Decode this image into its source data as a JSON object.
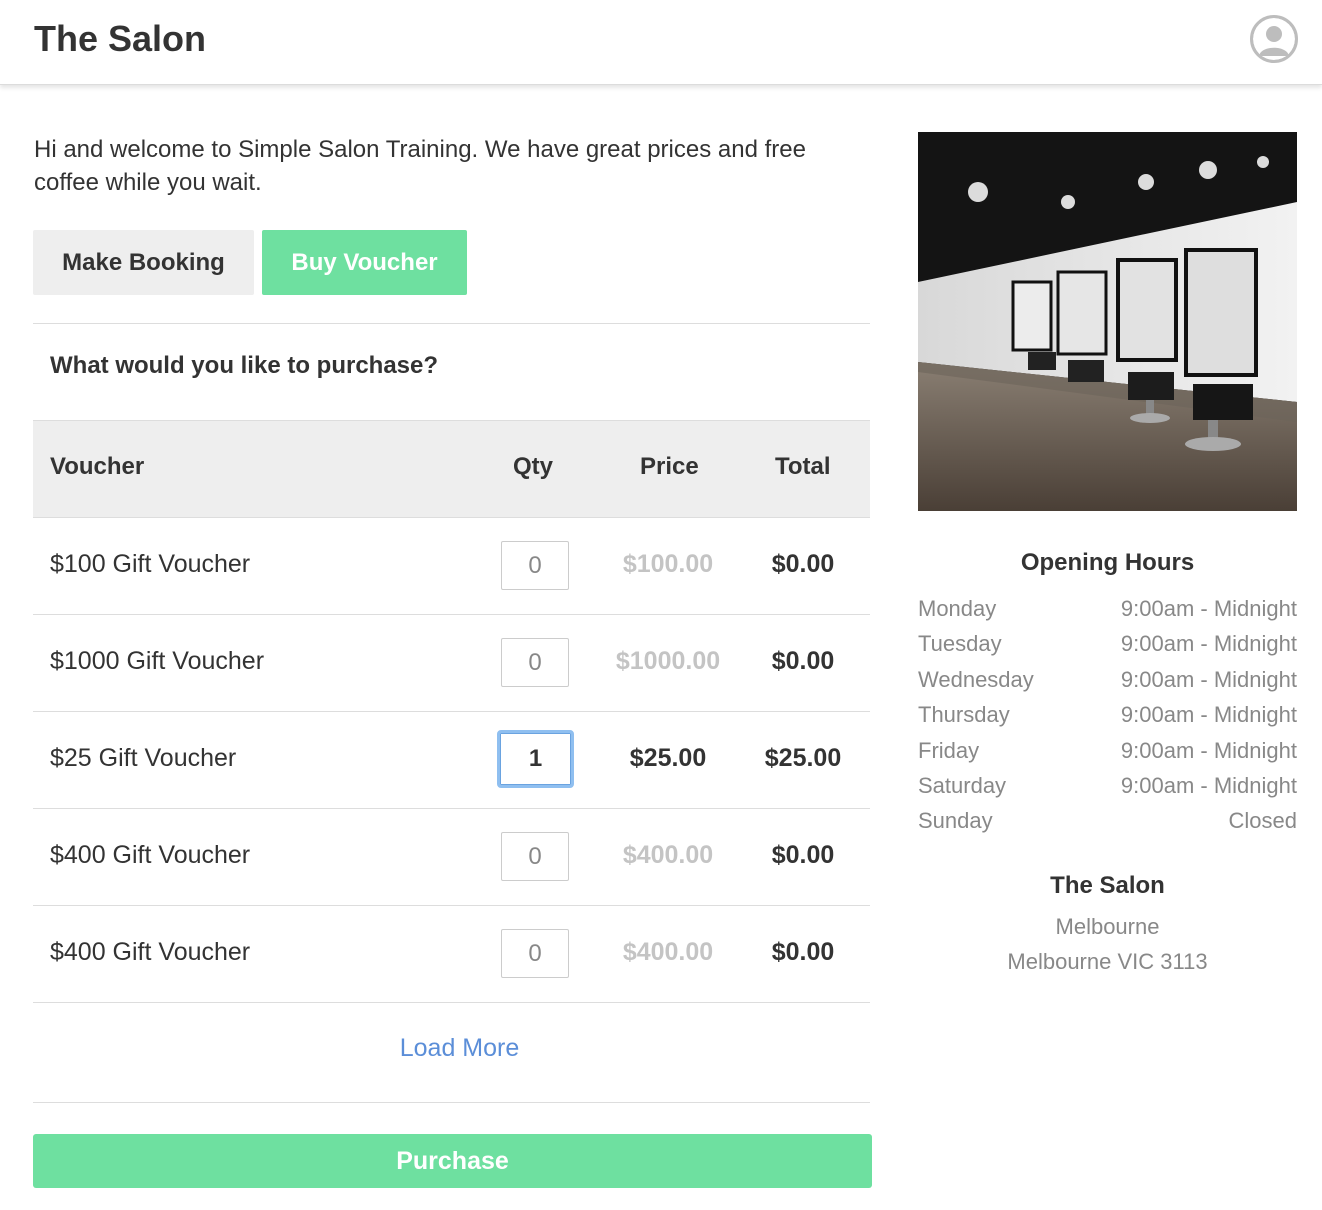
{
  "header": {
    "title": "The Salon"
  },
  "welcome": "Hi and welcome to Simple Salon Training. We have great prices and free coffee while you wait.",
  "tabs": {
    "booking": "Make Booking",
    "voucher": "Buy Voucher"
  },
  "question": "What would you like to purchase?",
  "table": {
    "headers": {
      "voucher": "Voucher",
      "qty": "Qty",
      "price": "Price",
      "total": "Total"
    },
    "rows": [
      {
        "name": "$100 Gift Voucher",
        "qty": "0",
        "price": "$100.00",
        "total": "$0.00"
      },
      {
        "name": "$1000 Gift Voucher",
        "qty": "0",
        "price": "$1000.00",
        "total": "$0.00"
      },
      {
        "name": "$25 Gift Voucher",
        "qty": "1",
        "price": "$25.00",
        "total": "$25.00"
      },
      {
        "name": "$400 Gift Voucher",
        "qty": "0",
        "price": "$400.00",
        "total": "$0.00"
      },
      {
        "name": "$400 Gift Voucher",
        "qty": "0",
        "price": "$400.00",
        "total": "$0.00"
      }
    ]
  },
  "load_more": "Load More",
  "purchase": "Purchase",
  "sidebar": {
    "hours_title": "Opening Hours",
    "hours": [
      {
        "day": "Monday",
        "time": "9:00am - Midnight"
      },
      {
        "day": "Tuesday",
        "time": "9:00am - Midnight"
      },
      {
        "day": "Wednesday",
        "time": "9:00am - Midnight"
      },
      {
        "day": "Thursday",
        "time": "9:00am - Midnight"
      },
      {
        "day": "Friday",
        "time": "9:00am - Midnight"
      },
      {
        "day": "Saturday",
        "time": "9:00am - Midnight"
      },
      {
        "day": "Sunday",
        "time": "Closed"
      }
    ],
    "salon_name": "The Salon",
    "address_line1": "Melbourne",
    "address_line2": "Melbourne VIC 3113"
  },
  "colors": {
    "accent": "#6ee0a0",
    "link": "#5b8ed8",
    "muted": "#888888"
  }
}
